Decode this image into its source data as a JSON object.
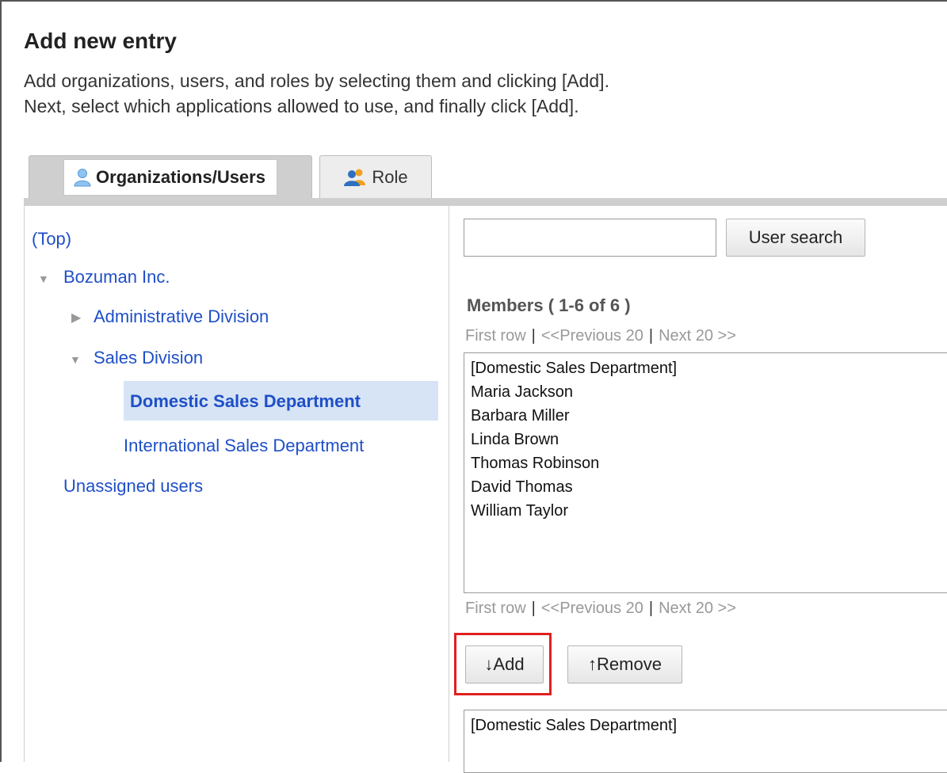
{
  "header": {
    "title": "Add new entry",
    "description_line1": "Add organizations, users, and roles by selecting them and clicking [Add].",
    "description_line2": "Next, select which applications allowed to use, and finally click [Add]."
  },
  "tabs": [
    {
      "label": "Organizations/Users",
      "icon": "user-icon",
      "active": true
    },
    {
      "label": "Role",
      "icon": "role-icon",
      "active": false
    }
  ],
  "tree": {
    "top": "(Top)",
    "root": "Bozuman Inc.",
    "administrative": "Administrative Division",
    "sales": "Sales Division",
    "domestic": "Domestic Sales Department",
    "international": "International Sales Department",
    "unassigned": "Unassigned users"
  },
  "search": {
    "value": "",
    "placeholder": "",
    "button_label": "User search"
  },
  "members": {
    "title": "Members ( 1-6 of 6 )",
    "pager": {
      "first": "First row",
      "previous": "<<Previous 20",
      "next": "Next 20 >>"
    },
    "items": [
      "[Domestic Sales Department]",
      "Maria Jackson",
      "Barbara Miller",
      "Linda Brown",
      "Thomas Robinson",
      "David Thomas",
      "William Taylor"
    ]
  },
  "actions": {
    "add_label": "↓Add",
    "remove_label": "↑Remove"
  },
  "selected": {
    "items": [
      "[Domestic Sales Department]"
    ]
  },
  "colors": {
    "link": "#1f4fc7",
    "selected_bg": "#d6e4f5",
    "highlight": "#e0201f"
  }
}
